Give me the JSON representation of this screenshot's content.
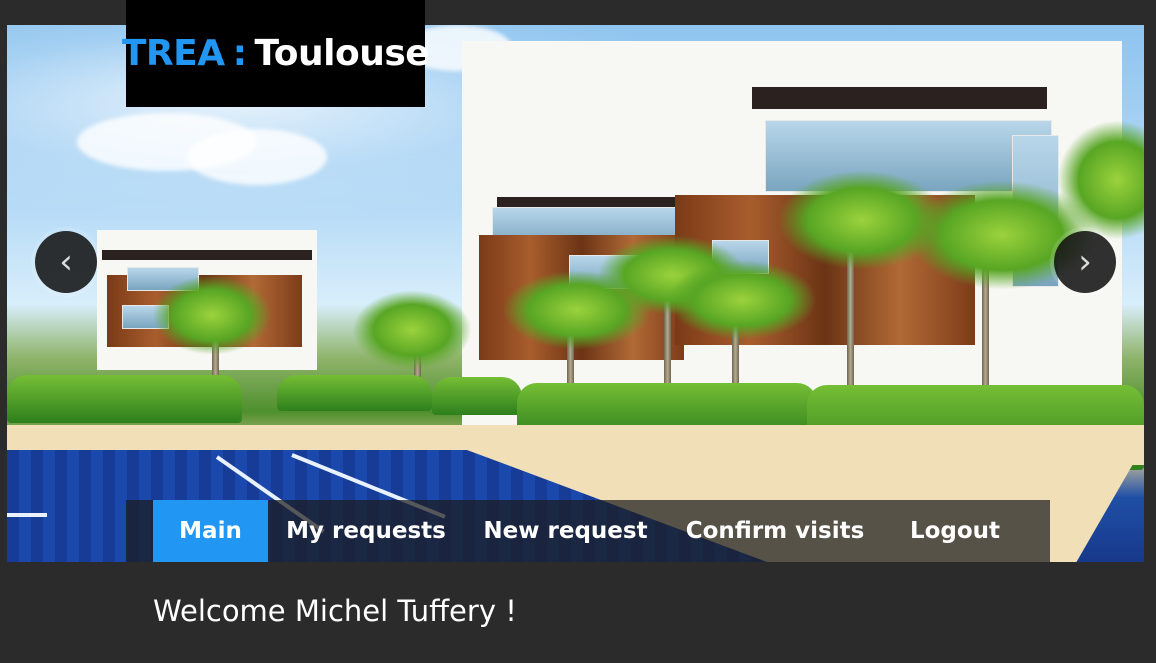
{
  "logo": {
    "brand": "TREA",
    "separator": ":",
    "city": "Toulouse"
  },
  "carousel": {
    "prev_icon": "chevron-left-icon",
    "next_icon": "chevron-right-icon",
    "prev_glyph": "‹",
    "next_glyph": "›"
  },
  "nav": {
    "items": [
      {
        "label": "Main",
        "active": true
      },
      {
        "label": "My requests",
        "active": false
      },
      {
        "label": "New request",
        "active": false
      },
      {
        "label": "Confirm visits",
        "active": false
      },
      {
        "label": "Logout",
        "active": false
      }
    ]
  },
  "welcome": "Welcome Michel Tuffery !",
  "colors": {
    "accent": "#2196f3",
    "background": "#2b2b2b",
    "nav_background": "#1c1c1c"
  }
}
